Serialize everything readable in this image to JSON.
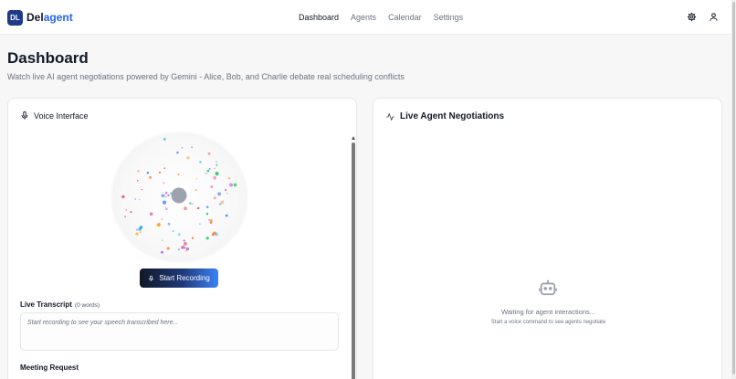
{
  "app": {
    "logo_text": "DL",
    "brand_main": "Del",
    "brand_accent": "agent"
  },
  "nav": {
    "items": [
      {
        "label": "Dashboard",
        "active": true
      },
      {
        "label": "Agents",
        "active": false
      },
      {
        "label": "Calendar",
        "active": false
      },
      {
        "label": "Settings",
        "active": false
      }
    ],
    "icons": [
      "gear-icon",
      "user-icon"
    ]
  },
  "header": {
    "title": "Dashboard",
    "subtitle": "Watch live AI agent negotiations powered by Gemini - Alice, Bob, and Charlie debate real scheduling conflicts"
  },
  "voice": {
    "title": "Voice Interface",
    "record_label": "Start Recording",
    "transcript_label": "Live Transcript",
    "word_count": "(0 words)",
    "transcript_placeholder": "Start recording to see your speech transcribed here...",
    "meeting_label": "Meeting Request"
  },
  "negotiations": {
    "title": "Live Agent Negotiations",
    "empty_title": "Waiting for agent interactions...",
    "empty_sub": "Start a voice command to see agents negotiate"
  },
  "colors": {
    "brand": "#2563eb",
    "logo_bg": "#1e3a8a",
    "orb_dots": [
      "#f97316",
      "#a855f7",
      "#06b6d4",
      "#ec4899",
      "#3b82f6",
      "#22c55e",
      "#f59e0b",
      "#ef4444"
    ]
  }
}
